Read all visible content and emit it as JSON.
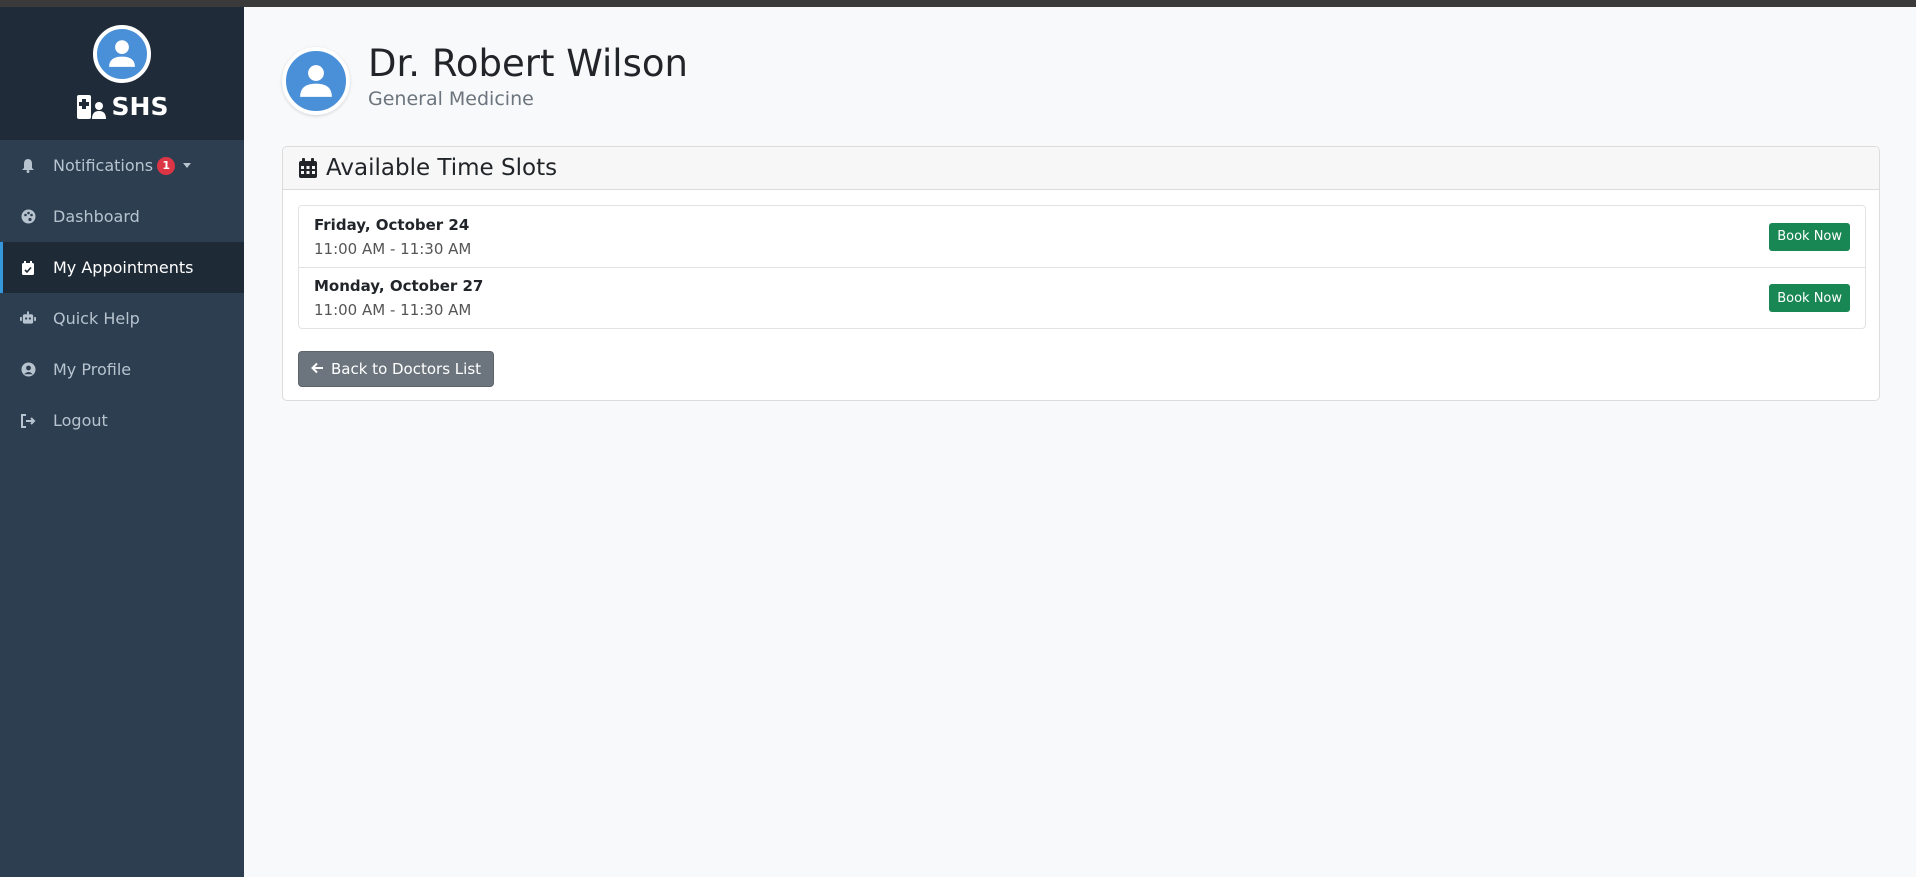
{
  "app": {
    "brand": "SHS"
  },
  "sidebar": {
    "items": [
      {
        "label": "Notifications",
        "badge": "1",
        "icon": "bell-icon"
      },
      {
        "label": "Dashboard",
        "icon": "palette-icon"
      },
      {
        "label": "My Appointments",
        "icon": "calendar-check-icon",
        "active": true
      },
      {
        "label": "Quick Help",
        "icon": "robot-icon"
      },
      {
        "label": "My Profile",
        "icon": "user-circle-icon"
      },
      {
        "label": "Logout",
        "icon": "sign-out-icon"
      }
    ]
  },
  "doctor": {
    "name": "Dr. Robert Wilson",
    "specialty": "General Medicine"
  },
  "slots_card": {
    "title": "Available Time Slots",
    "slots": [
      {
        "day": "Friday, October 24",
        "time": "11:00 AM - 11:30 AM",
        "button": "Book Now"
      },
      {
        "day": "Monday, October 27",
        "time": "11:00 AM - 11:30 AM",
        "button": "Book Now"
      }
    ],
    "back_label": "Back to Doctors List"
  },
  "colors": {
    "sidebar": "#2c3e50",
    "brand_bg": "#1f2b38",
    "accent": "#3498db",
    "book_button": "#198754",
    "back_button": "#6c757d",
    "badge": "#dc3545"
  }
}
